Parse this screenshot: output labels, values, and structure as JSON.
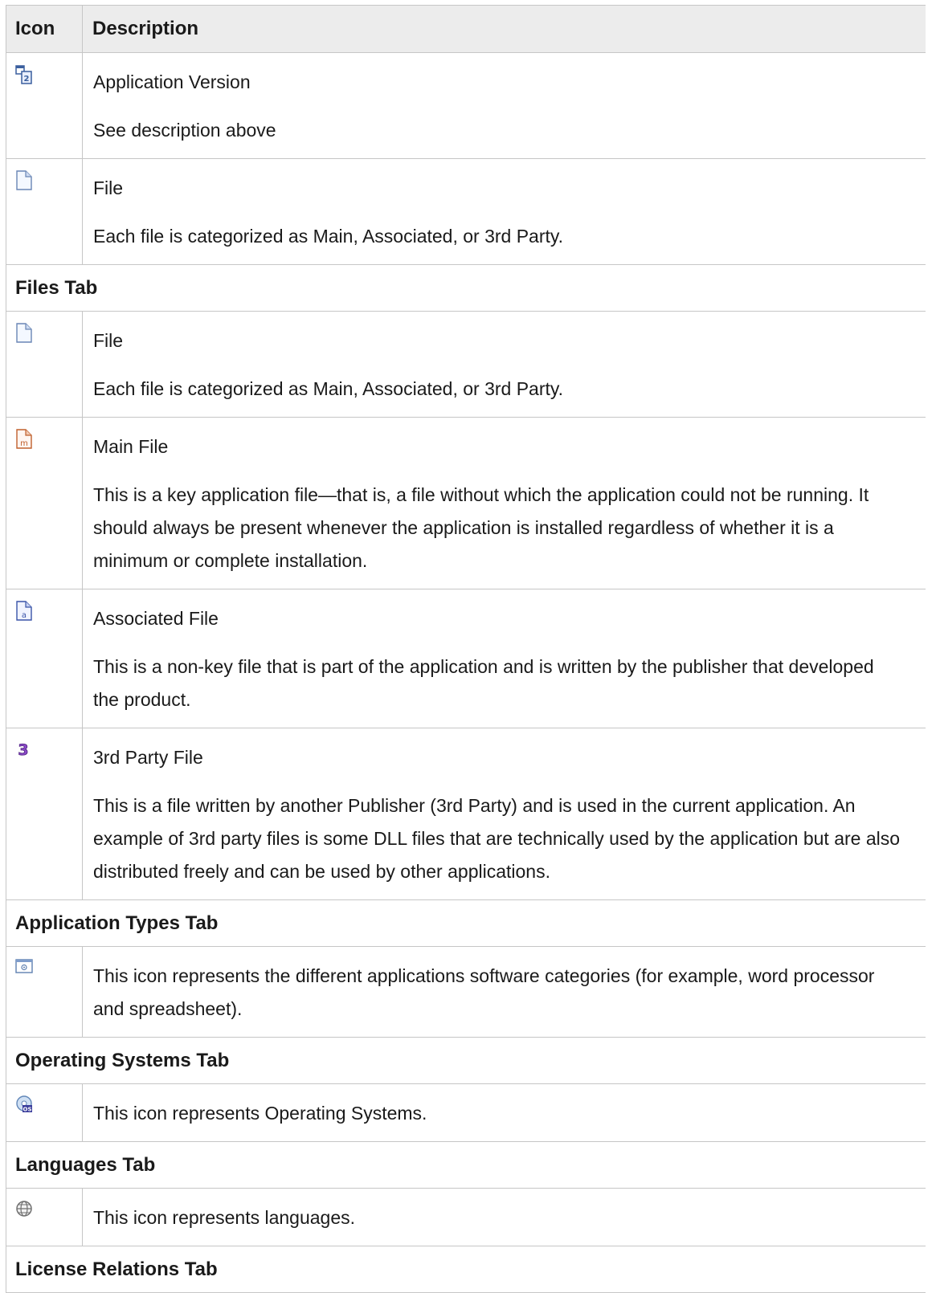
{
  "header": {
    "icon_label": "Icon",
    "description_label": "Description"
  },
  "groups": [
    {
      "rows": [
        {
          "icon": "application-version-icon",
          "title": "Application Version",
          "text": "See description above"
        },
        {
          "icon": "file-icon",
          "title": "File",
          "text": "Each file is categorized as Main, Associated, or 3rd Party."
        }
      ]
    },
    {
      "section": "Files Tab",
      "rows": [
        {
          "icon": "file-icon",
          "title": "File",
          "text": "Each file is categorized as Main, Associated, or 3rd Party."
        },
        {
          "icon": "main-file-icon",
          "title": "Main File",
          "text": "This is a key application file—that is, a file without which the application could not be running. It should always be present whenever the application is installed regardless of whether it is a minimum or complete installation."
        },
        {
          "icon": "associated-file-icon",
          "title": "Associated File",
          "text": "This is a non-key file that is part of the application and is written by the publisher that developed the product."
        },
        {
          "icon": "third-party-file-icon",
          "title": "3rd Party File",
          "text": "This is a file written by another Publisher (3rd Party) and is used in the current application. An example of 3rd party files is some DLL files that are technically used by the application but are also distributed freely and can be used by other applications."
        }
      ]
    },
    {
      "section": "Application Types Tab",
      "rows": [
        {
          "icon": "application-type-icon",
          "text": "This icon represents the different applications software categories (for example, word processor and spreadsheet)."
        }
      ]
    },
    {
      "section": "Operating Systems Tab",
      "rows": [
        {
          "icon": "operating-system-icon",
          "text": "This icon represents Operating Systems."
        }
      ]
    },
    {
      "section": "Languages Tab",
      "rows": [
        {
          "icon": "language-globe-icon",
          "text": "This icon represents languages."
        }
      ]
    },
    {
      "section": "License Relations Tab",
      "rows": []
    }
  ]
}
